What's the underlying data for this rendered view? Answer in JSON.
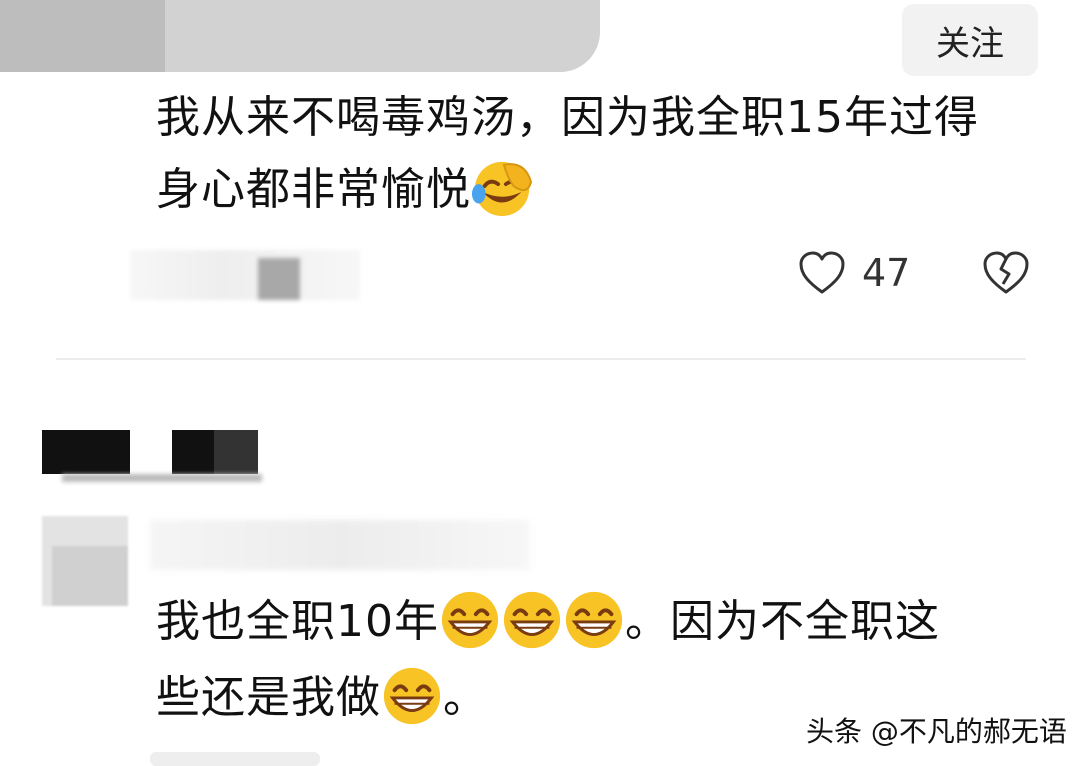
{
  "follow_button": {
    "label": "关注"
  },
  "comment1": {
    "line1": "我从来不喝毒鸡汤，因为我全职15年过得",
    "line2_text": "身心都非常愉悦",
    "line2_emoji": "laughing-emoji",
    "likes": "47"
  },
  "comment2": {
    "line1_text": "我也全职10年",
    "line1_emojis": [
      "grin-emoji",
      "grin-emoji",
      "grin-emoji"
    ],
    "line1_tail": "。因为不全职这",
    "line2_text": "些还是我做",
    "line2_emoji": "grin-emoji",
    "line2_tail": "。"
  },
  "watermark": {
    "text": "头条 @不凡的郝无语"
  },
  "colors": {
    "text": "#111111",
    "follow_bg": "#f2f2f2",
    "divider": "#ececec",
    "emoji_yellow": "#f7c325"
  }
}
